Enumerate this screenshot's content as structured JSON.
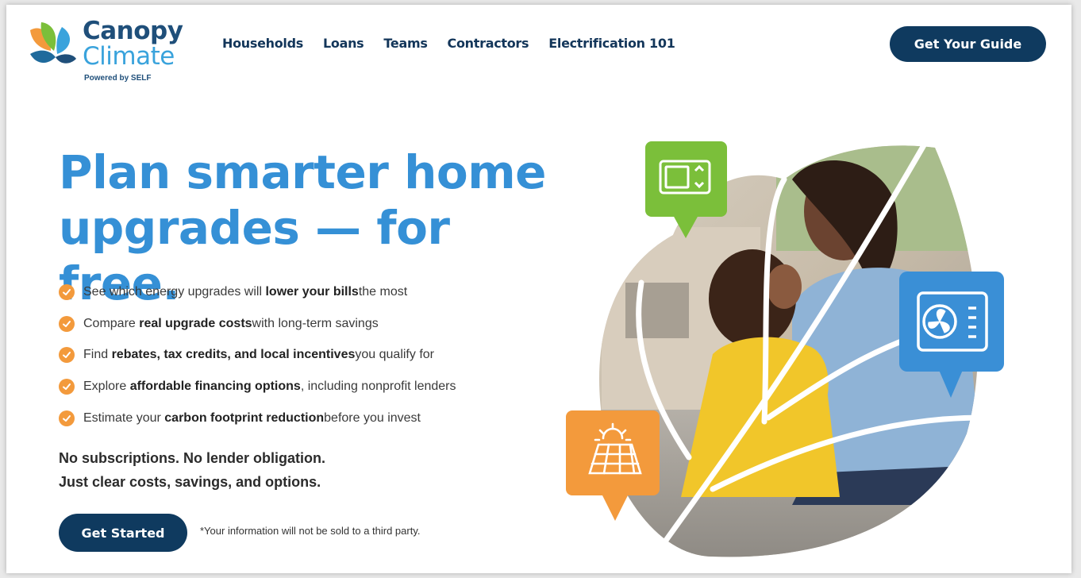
{
  "brand": {
    "name_line1": "Canopy",
    "name_line2": "Climate",
    "powered_by": "Powered by SELF",
    "colors": {
      "navy": "#0f3a5f",
      "blue": "#3590d6",
      "orange": "#f39a3c",
      "green": "#7bbf3a",
      "sky": "#3a8fd6"
    }
  },
  "nav": {
    "items": [
      "Households",
      "Loans",
      "Teams",
      "Contractors",
      "Electrification 101"
    ],
    "cta": "Get Your Guide"
  },
  "hero": {
    "title_line1": "Plan smarter home",
    "title_line2": "upgrades — for free.",
    "features": [
      {
        "pre": "See which energy upgrades will ",
        "bold": "lower your bills",
        "post": " the most"
      },
      {
        "pre": "Compare ",
        "bold": "real upgrade costs",
        "post": " with long-term savings"
      },
      {
        "pre": "Find ",
        "bold": "rebates, tax credits, and local incentives",
        "post": " you qualify for"
      },
      {
        "pre": "Explore ",
        "bold": "affordable financing options",
        "post": ", including nonprofit lenders"
      },
      {
        "pre": "Estimate your ",
        "bold": "carbon footprint reduction",
        "post": " before you invest"
      }
    ],
    "tagline_line1": "No subscriptions. No lender obligation.",
    "tagline_line2": "Just clear costs, savings, and options.",
    "cta": "Get Started",
    "disclaimer": "*Your information will not be sold to a third party."
  },
  "icons": {
    "thermostat": "thermostat-icon",
    "heat_pump": "heat-pump-icon",
    "solar": "solar-panel-icon",
    "check": "check-icon"
  }
}
